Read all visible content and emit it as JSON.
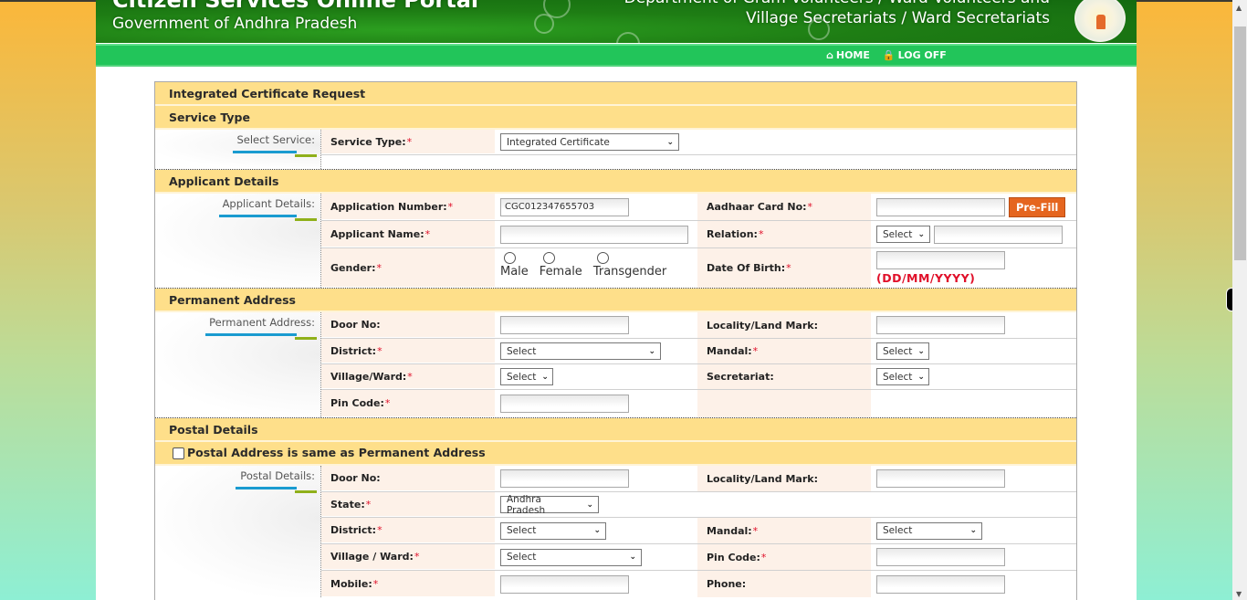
{
  "header": {
    "title_line1": "Citizen Services Online Portal",
    "title_line2": "Government of Andhra Pradesh",
    "dept_line1": "Department of Gram Volunteers / Ward Volunteers and",
    "dept_line2": "Village Secretariats / Ward Secretariats",
    "emblem_icon": "ap-state-emblem"
  },
  "nav": {
    "home_label": "HOME",
    "home_icon": "home-icon",
    "logoff_label": "LOG OFF",
    "logoff_icon": "lock-icon"
  },
  "form": {
    "title": "Integrated Certificate Request",
    "service_type": {
      "heading": "Service Type",
      "side_label": "Select Service:",
      "field_label": "Service Type:",
      "selected": "Integrated Certificate"
    },
    "applicant": {
      "heading": "Applicant Details",
      "side_label": "Applicant Details:",
      "application_number_label": "Application Number:",
      "application_number_value": "CGC012347655703",
      "aadhaar_label": "Aadhaar Card No:",
      "aadhaar_value": "",
      "prefill_label": "Pre-Fill",
      "name_label": "Applicant Name:",
      "name_value": "",
      "relation_label": "Relation:",
      "relation_selected": "Select",
      "relation_name_value": "",
      "gender_label": "Gender:",
      "gender_options": [
        "Male",
        "Female",
        "Transgender"
      ],
      "dob_label": "Date Of Birth:",
      "dob_value": "",
      "dob_hint": "(DD/MM/YYYY)"
    },
    "permanent": {
      "heading": "Permanent Address",
      "side_label": "Permanent Address:",
      "door_label": "Door No:",
      "locality_label": "Locality/Land Mark:",
      "district_label": "District:",
      "district_selected": "Select",
      "mandal_label": "Mandal:",
      "mandal_selected": "Select",
      "village_label": "Village/Ward:",
      "village_selected": "Select",
      "secretariat_label": "Secretariat:",
      "secretariat_selected": "Select",
      "pincode_label": "Pin Code:"
    },
    "postal": {
      "heading": "Postal Details",
      "same_checkbox_label": "Postal Address is same as Permanent Address",
      "same_checked": false,
      "side_label": "Postal Details:",
      "door_label": "Door No:",
      "locality_label": "Locality/Land Mark:",
      "state_label": "State:",
      "state_selected": "Andhra Pradesh",
      "district_label": "District:",
      "district_selected": "Select",
      "mandal_label": "Mandal:",
      "mandal_selected": "Select",
      "village_label": "Village / Ward:",
      "village_selected": "Select",
      "pincode_label": "Pin Code:",
      "mobile_label": "Mobile:",
      "phone_label": "Phone:"
    },
    "required_marker": "*"
  },
  "colors": {
    "section_bg": "#fedf8a",
    "label_bg": "#fdf1e8",
    "nav_green": "#22c55a",
    "prefill_orange": "#e5651f",
    "required_red": "#e0102a"
  }
}
